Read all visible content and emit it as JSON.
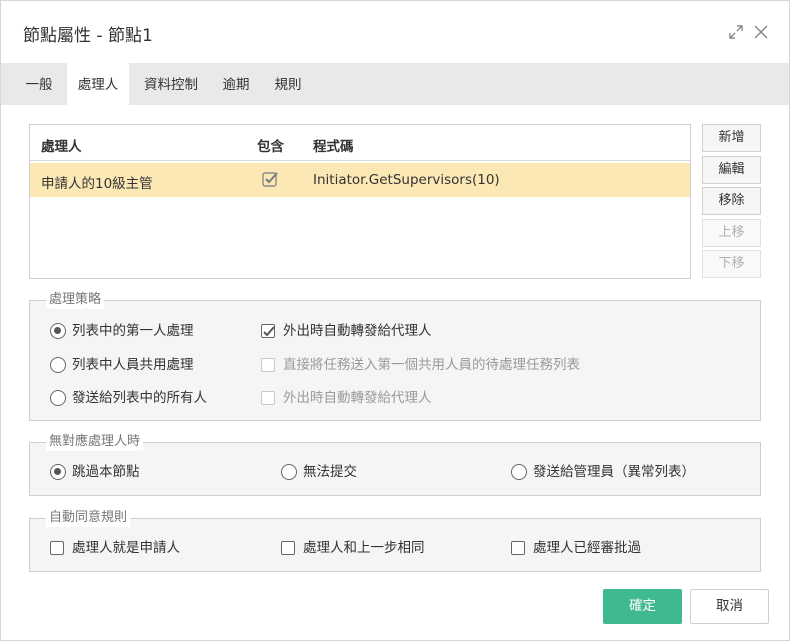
{
  "dialog": {
    "title": "節點屬性 - 節點1"
  },
  "tabs": [
    {
      "label": "一般"
    },
    {
      "label": "處理人",
      "active": true
    },
    {
      "label": "資料控制"
    },
    {
      "label": "逾期"
    },
    {
      "label": "規則"
    }
  ],
  "handlers": {
    "columns": [
      "處理人",
      "包含",
      "程式碼"
    ],
    "rows": [
      {
        "name": "申請人的10級主管",
        "included": true,
        "code": "Initiator.GetSupervisors(10)"
      }
    ],
    "selected_row_color": "#fbe8b5"
  },
  "side_buttons": {
    "add": "新增",
    "edit": "編輯",
    "remove": "移除",
    "up": "上移",
    "down": "下移"
  },
  "strategy": {
    "legend": "處理策略",
    "options": [
      {
        "label": "列表中的第一人處理",
        "selected": true
      },
      {
        "label": "列表中人員共用處理",
        "selected": false
      },
      {
        "label": "發送給列表中的所有人",
        "selected": false
      }
    ],
    "checks": [
      {
        "label": "外出時自動轉發給代理人",
        "checked": true,
        "enabled": true
      },
      {
        "label": "直接將任務送入第一個共用人員的待處理任務列表",
        "checked": false,
        "enabled": false
      },
      {
        "label": "外出時自動轉發給代理人",
        "checked": false,
        "enabled": false
      }
    ]
  },
  "no_handler": {
    "legend": "無對應處理人時",
    "options": [
      {
        "label": "跳過本節點",
        "selected": true
      },
      {
        "label": "無法提交",
        "selected": false
      },
      {
        "label": "發送給管理員（異常列表）",
        "selected": false
      }
    ]
  },
  "auto_approve": {
    "legend": "自動同意規則",
    "checks": [
      {
        "label": "處理人就是申請人",
        "checked": false
      },
      {
        "label": "處理人和上一步相同",
        "checked": false
      },
      {
        "label": "處理人已經審批過",
        "checked": false
      }
    ]
  },
  "footer": {
    "ok": "確定",
    "cancel": "取消",
    "accent": "#3fb98e"
  }
}
